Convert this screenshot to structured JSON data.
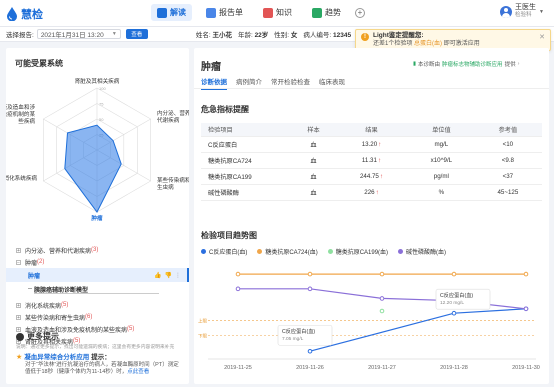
{
  "app": {
    "name": "慧检"
  },
  "nav": {
    "tabs": [
      {
        "label": "解读",
        "active": true
      },
      {
        "label": "报告单",
        "active": false
      },
      {
        "label": "知识",
        "active": false
      },
      {
        "label": "趋势",
        "active": false
      }
    ],
    "add_label": "+"
  },
  "user": {
    "name": "王医生",
    "role": "检验科"
  },
  "subbar": {
    "date_label": "选择报告:",
    "date_value": "2021年1月31日 13:20",
    "query_label": "查看",
    "patient": {
      "name_label": "姓名:",
      "name": "王小花",
      "age_label": "年龄:",
      "age": "22岁",
      "sex_label": "性别:",
      "sex": "女",
      "id_label": "病人编号:",
      "id": "12345"
    }
  },
  "toast": {
    "title": "Light鉴定提醒您:",
    "text_prefix": "还差",
    "text_count": "1",
    "text_mid": "个检验项",
    "text_item": "总蛋白(血)",
    "text_suffix": "即可激活应用"
  },
  "left": {
    "title": "可能受累系统",
    "radar_labels": [
      "肾脏及其相关疾病",
      "内分泌、营养和代谢疾病",
      "某些传染病和寄生虫病",
      "肿瘤",
      "消化系统疾病",
      "血液及造血和涉及免疫机制的某些疾病"
    ],
    "radar_ticks": [
      "100",
      "75",
      "50",
      "25"
    ],
    "radar_values": [
      40,
      30,
      45,
      100,
      60,
      55
    ],
    "tree": [
      {
        "label": "内分泌、营养和代谢疾病",
        "count": "(3)",
        "expanded": false
      },
      {
        "label": "肿瘤",
        "count": "(2)",
        "expanded": true
      },
      {
        "label": "肿瘤",
        "selected": true
      },
      {
        "label": "胰腺癌辅助诊断模型",
        "sub": true
      },
      {
        "label": "消化系统疾病",
        "count": "(5)",
        "expanded": false
      },
      {
        "label": "某些传染病和寄生虫病",
        "count": "(6)",
        "expanded": false
      },
      {
        "label": "血液及造血和涉及免疫机制的某些疾病",
        "count": "(5)",
        "expanded": false
      },
      {
        "label": "肾脏及其相关疾病",
        "count": "(5)",
        "expanded": false
      }
    ],
    "more_title": "更多提示",
    "more_sub": "说明：通过更多提示，找出可能遗漏的疾病；这里会有更多内容说明来补充",
    "tip_title": "凝血异常综合分析应用",
    "tip_title_suffix": "提示：",
    "tip_text": "对于“华法林”进行抗凝治疗的病人，若凝血酶原时间（PT）测定值低于18秒（健康个体约为11-14秒）时，",
    "tip_more": "点此查看"
  },
  "right": {
    "title": "肿瘤",
    "link_prefix": "本诊断由",
    "link_name": "肿瘤标志物辅助诊断应用",
    "link_suffix": "提供",
    "tabs": [
      "诊断依据",
      "病例简介",
      "常开检验检查",
      "临床表现"
    ],
    "danger_title": "危急指标提醒",
    "table_headers": [
      "检验项目",
      "样本",
      "结果",
      "单位值",
      "参考值"
    ],
    "table_rows": [
      {
        "item": "C反应蛋白",
        "sample": "血",
        "result": "13.20",
        "flag": "↑",
        "unit": "mg/L",
        "ref": "<10"
      },
      {
        "item": "糖类抗原CA724",
        "sample": "血",
        "result": "11.31",
        "flag": "↑",
        "unit": "x10^9/L",
        "ref": "<9.8"
      },
      {
        "item": "糖类抗原CA199",
        "sample": "血",
        "result": "244.75",
        "flag": "↑",
        "unit": "pg/ml",
        "ref": "<37"
      },
      {
        "item": "碱性磷酸酶",
        "sample": "血",
        "result": "226",
        "flag": "↑",
        "unit": "%",
        "ref": "45~125"
      }
    ],
    "trend_title": "检验项目趋势图"
  },
  "chart_data": {
    "type": "line",
    "x": [
      "2019-11-25",
      "2019-11-26",
      "2019-11-27",
      "2019-11-28",
      "2019-11-30"
    ],
    "series": [
      {
        "name": "C反应蛋白(血)",
        "color": "#2b6fe0",
        "values": [
          null,
          7.05,
          null,
          12.2,
          12.8
        ]
      },
      {
        "name": "糖类抗原CA724(血)",
        "color": "#f0a64a",
        "values": [
          17.5,
          17.5,
          17.5,
          17.5,
          17.5
        ]
      },
      {
        "name": "糖类抗原CA199(血)",
        "color": "#8fe0a0",
        "values": [
          null,
          null,
          12.5,
          null,
          null
        ]
      },
      {
        "name": "碱性磷酸酶(血)",
        "color": "#8a6fd8",
        "values": [
          15.5,
          15.5,
          14.2,
          13.9,
          12.8
        ]
      }
    ],
    "reference_lines": [
      {
        "label": "上限",
        "value": 11.2
      },
      {
        "label": "下限",
        "value": 9.2
      }
    ],
    "tooltips": [
      {
        "title": "C反应蛋白(血)",
        "value": "7.05 mg/L"
      },
      {
        "title": "C反应蛋白(血)",
        "value": "12.20 mg/L"
      }
    ],
    "ylim": [
      6,
      19
    ]
  }
}
